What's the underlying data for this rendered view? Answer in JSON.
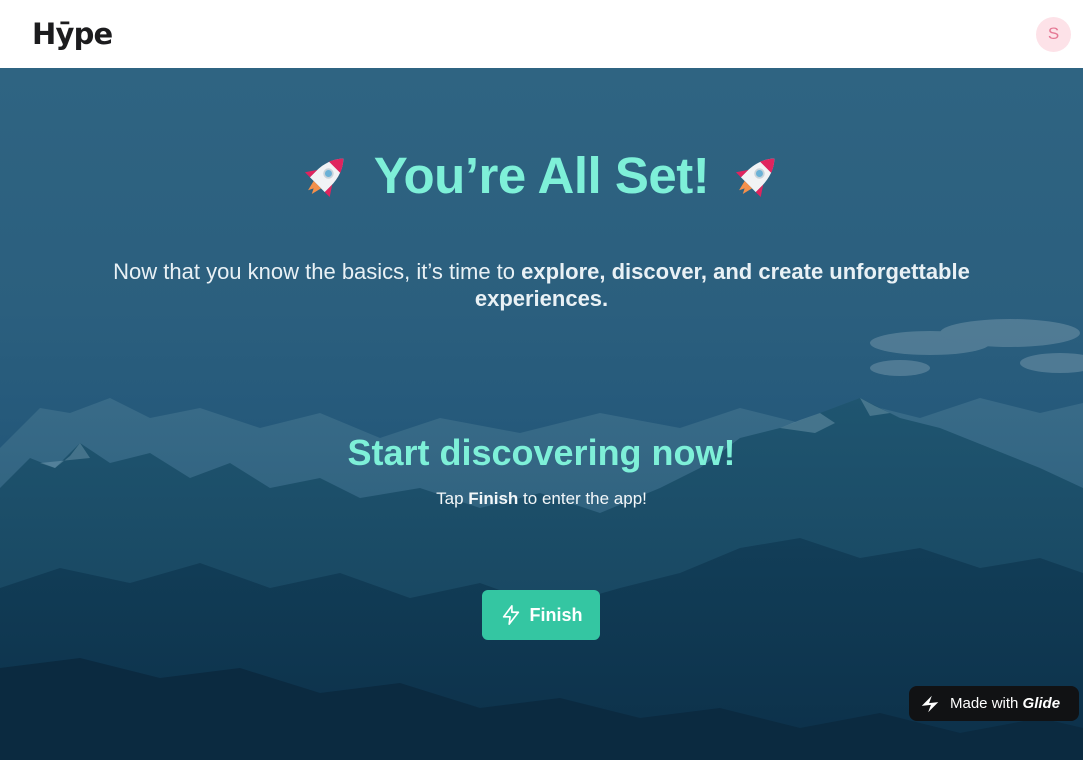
{
  "header": {
    "logo": "Hȳpe",
    "avatar_initial": "S"
  },
  "hero": {
    "title": "You’re All Set!",
    "subtitle_plain": "Now that you know the basics, it’s time to ",
    "subtitle_bold": "explore, discover, and create unforgettable experiences.",
    "cta_heading": "Start discovering now!",
    "cta_prefix": "Tap ",
    "cta_bold": "Finish",
    "cta_suffix": " to enter the app!",
    "finish_label": "Finish"
  },
  "badge": {
    "made_with": "Made with",
    "brand": "Glide"
  },
  "icons": {
    "title_left": "rocket-icon",
    "title_right": "rocket-icon",
    "finish": "lightning-bolt-icon",
    "badge": "glide-logo-icon"
  },
  "colors": {
    "accent_teal": "#7ef0d8",
    "button": "#34c6a2",
    "avatar_bg": "#fde2e8",
    "avatar_text": "#e57894"
  }
}
